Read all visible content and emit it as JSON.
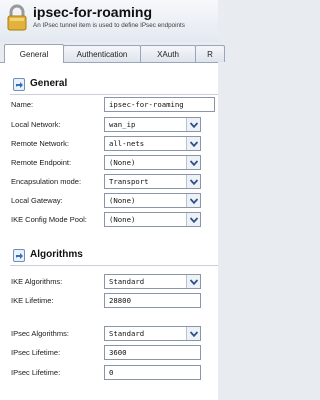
{
  "header": {
    "title": "ipsec-for-roaming",
    "subtitle": "An IPsec tunnel item is used to define IPsec endpoints"
  },
  "tabs": [
    {
      "label": "General",
      "active": true
    },
    {
      "label": "Authentication",
      "active": false
    },
    {
      "label": "XAuth",
      "active": false
    },
    {
      "label": "R",
      "active": false
    }
  ],
  "general": {
    "title": "General",
    "fields": [
      {
        "label": "Name:",
        "value": "ipsec-for-roaming",
        "type": "text"
      },
      {
        "label": "Local Network:",
        "value": "wan_ip",
        "type": "select"
      },
      {
        "label": "Remote Network:",
        "value": "all-nets",
        "type": "select"
      },
      {
        "label": "Remote Endpoint:",
        "value": "(None)",
        "type": "select"
      },
      {
        "label": "Encapsulation mode:",
        "value": "Transport",
        "type": "select"
      },
      {
        "label": "Local Gateway:",
        "value": "(None)",
        "type": "select"
      },
      {
        "label": "IKE Config Mode Pool:",
        "value": "(None)",
        "type": "select"
      }
    ]
  },
  "algorithms": {
    "title": "Algorithms",
    "fields": [
      {
        "label": "IKE Algorithms:",
        "value": "Standard",
        "type": "select"
      },
      {
        "label": "IKE Lifetime:",
        "value": "28800",
        "type": "text"
      },
      {
        "label": "IPsec Algorithms:",
        "value": "Standard",
        "type": "select"
      },
      {
        "label": "IPsec Lifetime:",
        "value": "3600",
        "type": "text"
      },
      {
        "label": "IPsec Lifetime:",
        "value": "0",
        "type": "text"
      }
    ]
  },
  "colors": {
    "accent": "#2f6fbd",
    "dropdown_arrow": "#2a4f8a"
  }
}
